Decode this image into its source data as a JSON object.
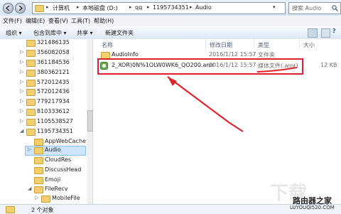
{
  "address": {
    "crumbs": [
      "计算机",
      "本地磁盘 (D:)",
      "qq",
      "1195734351",
      "Audio"
    ],
    "search_placeholder": "搜索 Audio"
  },
  "menu": [
    "文件(F)",
    "编辑(E)",
    "查看(V)",
    "工具(T)",
    "帮助(H)"
  ],
  "toolbar": {
    "organize": "组织 ▾",
    "include": "包含到库中 ▾",
    "share": "共享 ▾",
    "new_folder": "新建文件夹"
  },
  "sidebar": {
    "items": [
      "321486135",
      "356082058",
      "361184536",
      "380362121",
      "572012435",
      "572012436",
      "779217934",
      "810333612",
      "1105538527",
      "1195734351",
      "AppWebCache",
      "Audio",
      "CloudRes",
      "DiscussHead",
      "Emoji",
      "FileRecv",
      "MobileFile"
    ]
  },
  "columns": {
    "name": "名称",
    "modified": "修改日期",
    "type": "类型",
    "size": "大小"
  },
  "files": [
    {
      "name": "AudioInfo",
      "modified": "2016/1/12 15:57",
      "type": "文件夹",
      "size": ""
    },
    {
      "name": "2_XOR)0N%1OLW0WK6_QO200.amr",
      "modified": "2016/1/12 15:57",
      "type": "媒体文件(.amr)",
      "size": "12 KB"
    }
  ],
  "status": {
    "count": "2 个对象"
  },
  "watermark": {
    "brand": "路由器之家",
    "url": "LUYOUQI520.COM",
    "big": "下载"
  },
  "colors": {
    "annotation": "#e2222b",
    "selection": "#cde5fb",
    "folder": "#f2cf6e"
  }
}
